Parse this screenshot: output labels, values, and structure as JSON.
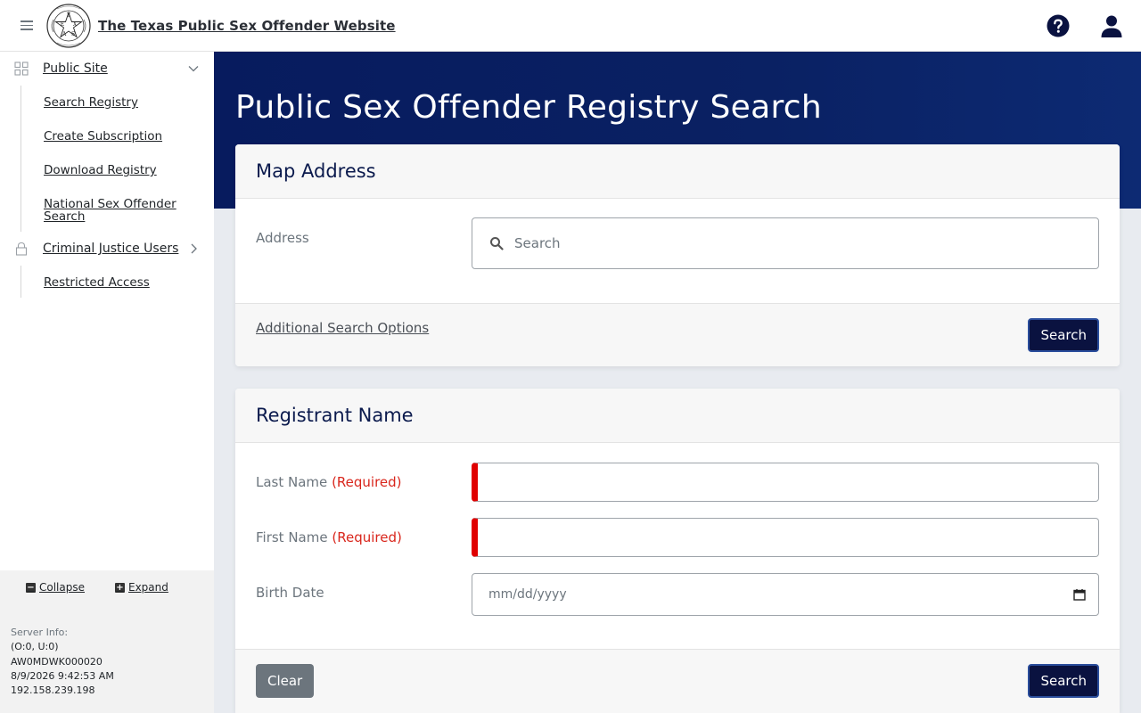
{
  "header": {
    "title": "The Texas Public Sex Offender Website",
    "seal_letters": [
      "T",
      "E",
      "X",
      "A",
      "S"
    ]
  },
  "sidebar": {
    "groups": [
      {
        "label": "Public Site",
        "icon": "grid-icon",
        "expanded": true,
        "items": [
          "Search Registry",
          "Create Subscription",
          "Download Registry",
          "National Sex Offender Search"
        ]
      },
      {
        "label": "Criminal Justice Users",
        "icon": "lock-icon",
        "expanded": false,
        "items": [
          "Restricted Access"
        ]
      }
    ],
    "footer": {
      "collapse_label": "Collapse",
      "expand_label": "Expand",
      "server_label": "Server Info:",
      "server_lines": [
        "(O:0, U:0)",
        "AW0MDWK000020",
        "8/9/2026 9:42:53 AM",
        "192.158.239.198"
      ]
    }
  },
  "main": {
    "page_title": "Public Sex Offender Registry Search",
    "map_address": {
      "title": "Map Address",
      "address_label": "Address",
      "address_placeholder": "Search",
      "additional_options": "Additional Search Options",
      "search_button": "Search"
    },
    "registrant_name": {
      "title": "Registrant Name",
      "last_name_label": "Last Name",
      "first_name_label": "First Name",
      "required_text": "(Required)",
      "birth_date_label": "Birth Date",
      "birth_date_placeholder": "mm/dd/yyyy",
      "clear_button": "Clear",
      "search_button": "Search"
    }
  },
  "colors": {
    "hero": "#0a2163",
    "primary_button": "#0a1240",
    "required": "#d9261c",
    "secondary_button": "#6c757d"
  }
}
